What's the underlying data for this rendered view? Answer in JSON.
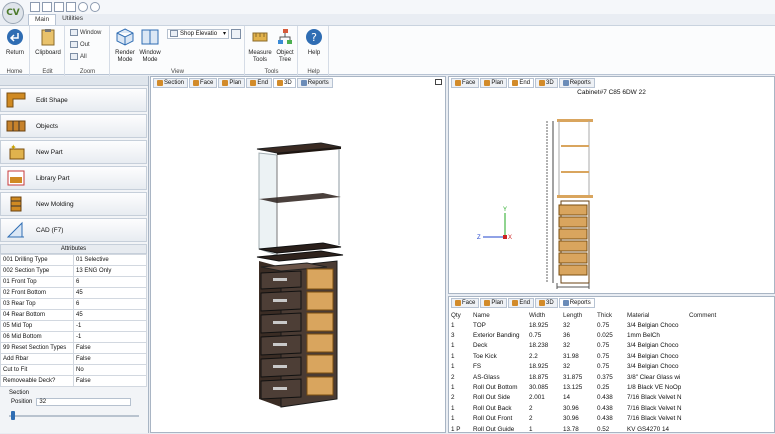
{
  "app": {
    "logo_text": "CV"
  },
  "ribbon": {
    "tabs": [
      "Main",
      "Utilities"
    ],
    "groups": {
      "home": {
        "label": "Home",
        "return": "Return"
      },
      "edit": {
        "label": "Edit",
        "clipboard": "Clipboard"
      },
      "zoom": {
        "label": "Zoom",
        "window": "Window",
        "out": "Out",
        "all": "All"
      },
      "view": {
        "label": "View",
        "render_mode": "Render Mode",
        "window_mode": "Window Mode",
        "elevation_select": "Shop Elevatio"
      },
      "tools": {
        "label": "Tools",
        "measure_tools": "Measure Tools",
        "object_tree": "Object Tree"
      },
      "help": {
        "label": "Help",
        "help": "Help"
      }
    }
  },
  "left_tools": [
    "Edit Shape",
    "Objects",
    "New Part",
    "Library Part",
    "New Molding",
    "CAD (F7)"
  ],
  "attributes": {
    "header": "Attributes",
    "rows": [
      [
        "001 Drilling Type",
        "01 Selective"
      ],
      [
        "002 Section Type",
        "13 ENG Only"
      ],
      [
        "01 Front Top",
        "6"
      ],
      [
        "02 Front Bottom",
        "45"
      ],
      [
        "03 Rear Top",
        "6"
      ],
      [
        "04 Rear Bottom",
        "45"
      ],
      [
        "05 Mid Top",
        "-1"
      ],
      [
        "06 Mid Bottom",
        "-1"
      ],
      [
        "99 Reset Section Types",
        "False"
      ],
      [
        "Add Rbar",
        "False"
      ],
      [
        "Cut to Fit",
        "No"
      ],
      [
        "Removeable Deck?",
        "False"
      ]
    ]
  },
  "section": {
    "label": "Section",
    "position_label": "Position",
    "position_value": "32"
  },
  "views": {
    "main_tabs": [
      "Section",
      "Face",
      "Plan",
      "End",
      "3D",
      "Reports"
    ],
    "main_active": "3D",
    "end_tabs": [
      "Face",
      "Plan",
      "End",
      "3D",
      "Reports"
    ],
    "end_active": "End",
    "end_title": "Cabinet#7 C85 6DW 22",
    "report_tabs": [
      "Face",
      "Plan",
      "End",
      "3D",
      "Reports"
    ],
    "report_active": "Reports"
  },
  "report": {
    "columns": [
      "Qty",
      "Name",
      "Width",
      "Length",
      "Thick",
      "Material",
      "Comment"
    ],
    "rows": [
      [
        "1",
        "TOP",
        "18.925",
        "32",
        "0.75",
        "3/4 Belgian Choco",
        ""
      ],
      [
        "3",
        "Exterior Banding",
        "0.75",
        "36",
        "0.025",
        "1mm BelCh",
        ""
      ],
      [
        "1",
        "Deck",
        "18.238",
        "32",
        "0.75",
        "3/4 Belgian Choco",
        ""
      ],
      [
        "1",
        "Toe Kick",
        "2.2",
        "31.98",
        "0.75",
        "3/4 Belgian Choco",
        ""
      ],
      [
        "1",
        "FS",
        "18.925",
        "32",
        "0.75",
        "3/4 Belgian Choco",
        ""
      ],
      [
        "2",
        "AS-Glass",
        "18.875",
        "31.875",
        "0.375",
        "3/8\" Clear Glass wi",
        ""
      ],
      [
        "1",
        "Roll Out Bottom",
        "30.085",
        "13.125",
        "0.25",
        "1/8 Black VE NoOp",
        ""
      ],
      [
        "2",
        "Roll Out Side",
        "2.001",
        "14",
        "0.438",
        "7/16 Black Velvet N",
        ""
      ],
      [
        "1",
        "Roll Out Back",
        "2",
        "30.96",
        "0.438",
        "7/16 Black Velvet N",
        ""
      ],
      [
        "1",
        "Roll Out Front",
        "2",
        "30.96",
        "0.438",
        "7/16 Black Velvet N",
        ""
      ],
      [
        "1 P",
        "Roll Out Guide",
        "1",
        "13.78",
        "0.52",
        "KV GS4270 14",
        ""
      ]
    ]
  },
  "axis_labels": {
    "y": "Y",
    "z": "Z",
    "x": "X"
  }
}
